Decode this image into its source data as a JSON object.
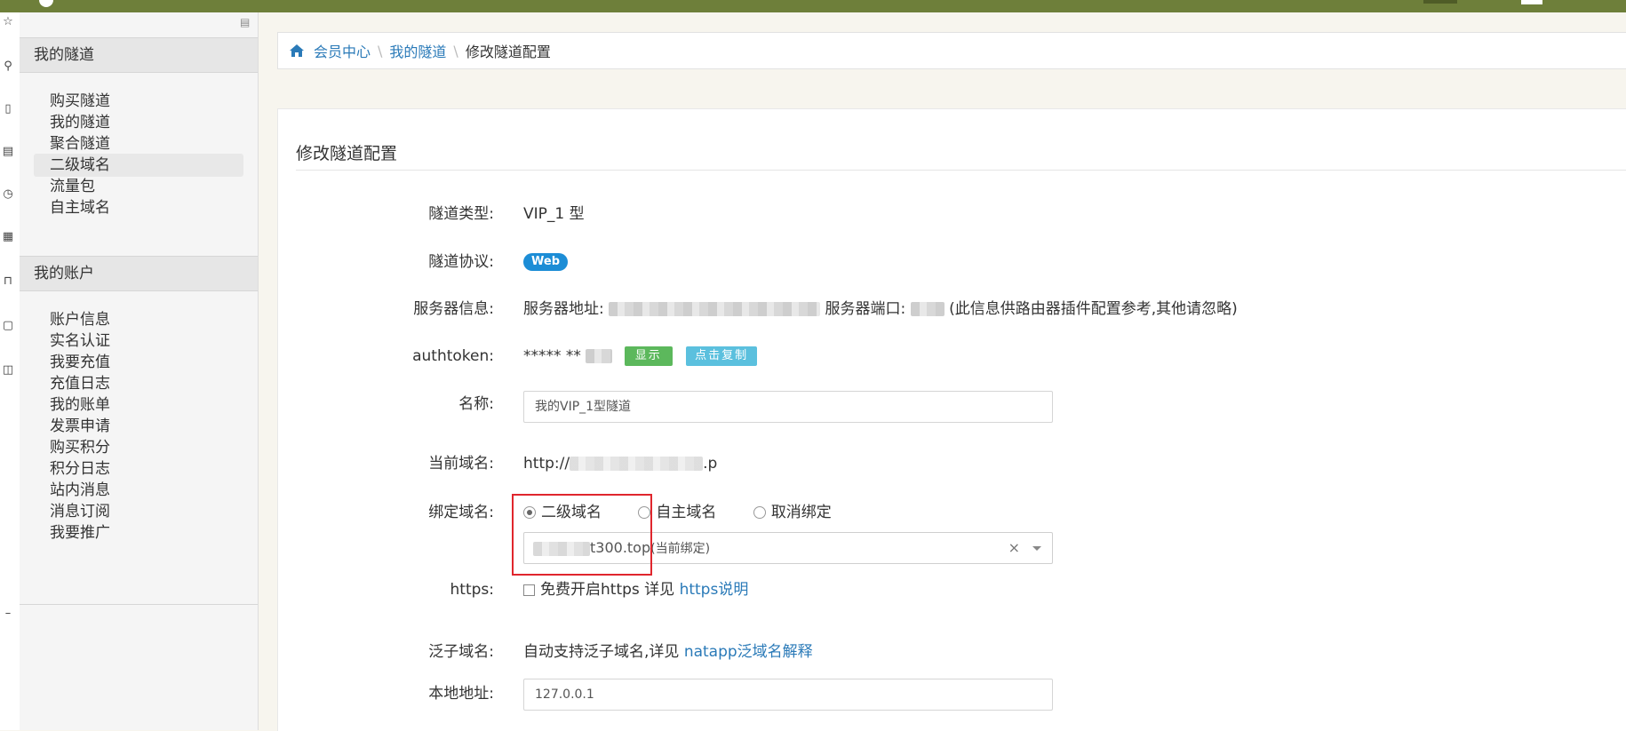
{
  "colors": {
    "topbar": "#6e7f3a",
    "link": "#2a7ab8",
    "web_badge": "#1c8dd6",
    "show_button": "#5cb85c",
    "copy_button": "#5bc0de",
    "highlight": "#e0262d"
  },
  "icons": [
    "home-icon",
    "menu-collapse-icon",
    "search-icon",
    "radio-icon",
    "checkbox-icon",
    "chevron-down-icon",
    "clear-icon"
  ],
  "sidebar": {
    "sections": [
      {
        "title": "我的隧道",
        "items": [
          "购买隧道",
          "我的隧道",
          "聚合隧道",
          "二级域名",
          "流量包",
          "自主域名"
        ]
      },
      {
        "title": "我的账户",
        "items": [
          "账户信息",
          "实名认证",
          "我要充值",
          "充值日志",
          "我的账单",
          "发票申请",
          "购买积分",
          "积分日志",
          "站内消息",
          "消息订阅",
          "我要推广"
        ]
      }
    ],
    "active_item": "二级域名"
  },
  "breadcrumb": {
    "items": [
      "会员中心",
      "我的隧道"
    ],
    "current": "修改隧道配置"
  },
  "form": {
    "title": "修改隧道配置",
    "tunnel_type": {
      "label": "隧道类型:",
      "value": "VIP_1 型"
    },
    "protocol": {
      "label": "隧道协议:",
      "badge": "Web"
    },
    "server": {
      "label": "服务器信息:",
      "addr_label": "服务器地址:",
      "port_label": "服务器端口:",
      "note": "(此信息供路由器插件配置参考,其他请忽略)"
    },
    "authtoken": {
      "label": "authtoken:",
      "masked": "*****  **",
      "show_button": "显示",
      "copy_button": "点击复制"
    },
    "name": {
      "label": "名称:",
      "value": "我的VIP_1型隧道"
    },
    "current_domain": {
      "label": "当前域名:",
      "prefix": "http://",
      "suffix": ".p"
    },
    "bind_domain": {
      "label": "绑定域名:",
      "options": [
        "二级域名",
        "自主域名",
        "取消绑定"
      ],
      "selected": 0,
      "select_value": "t300.top",
      "select_note": "(当前绑定)",
      "clear": "×"
    },
    "https": {
      "label": "https:",
      "checkbox_label": "免费开启https 详见",
      "link": "https说明"
    },
    "wildcard": {
      "label": "泛子域名:",
      "text": "自动支持泛子域名,详见",
      "link": "natapp泛域名解释"
    },
    "local_addr": {
      "label": "本地地址:",
      "value": "127.0.0.1"
    }
  }
}
